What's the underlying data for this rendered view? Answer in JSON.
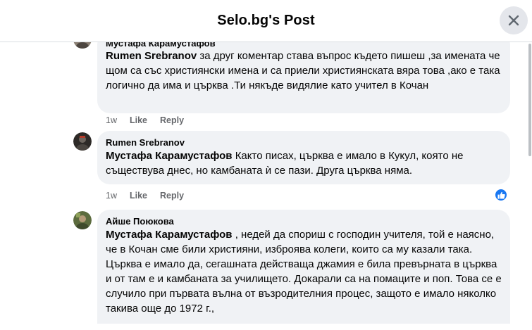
{
  "header": {
    "title": "Selo.bg's Post"
  },
  "comments": [
    {
      "author": "Мустафа Карамустафов",
      "mention": "Rumen Srebranov",
      "text": " за друг коментар става въпрос където пишеш ,за имената че щом са със християнски имена и са приели християнската вяра това ,ако е така логично да има и църква .Ти някъде видялие като учител в Кочан",
      "time": "1w",
      "like": "Like",
      "reply": "Reply"
    },
    {
      "author": "Rumen Srebranov",
      "mention": "Мустафа Карамустафов",
      "text": " Както писах, църква е имало в Кукул, която не съществува днес, но камбаната ѝ се пази. Друга църква няма.",
      "time": "1w",
      "like": "Like",
      "reply": "Reply"
    },
    {
      "author": "Айше Поюкова",
      "mention": "Мустафа Карамустафов",
      "text": " , недей да спориш с господин учителя, той е наясно, че в Кочан сме били християни, изброява колеги, които са му казали така. Църква е имало да, сегашната действаща джамия е била превърната в църква и от там е и камбаната за училището. Докарали са на помаците и поп. Това се е случило при първата вълна от възродителния процес, защото е имало няколко такива още до 1972 г.,",
      "time": "",
      "like": "",
      "reply": ""
    }
  ],
  "colors": {
    "bubble": "#f0f2f5",
    "like_badge": "#1877f2",
    "meta": "#65676b"
  }
}
